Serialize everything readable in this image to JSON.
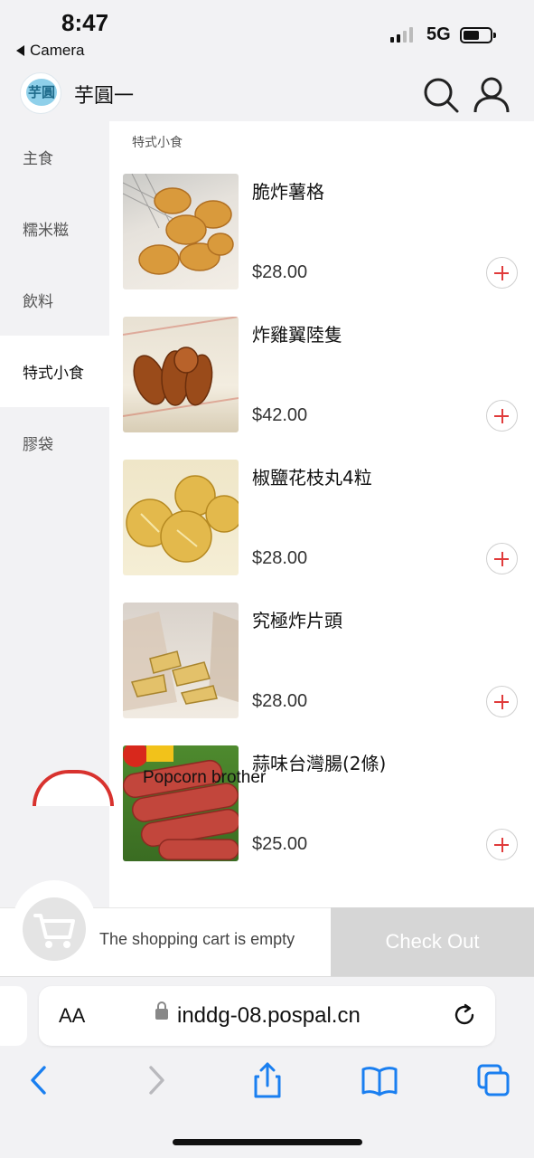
{
  "status_bar": {
    "time": "8:47",
    "back_label": "Camera",
    "network": "5G"
  },
  "header": {
    "shop_name": "芋圓一",
    "logo_text": "芋圓"
  },
  "sidebar": {
    "categories": [
      "主食",
      "糯米糍",
      "飲料",
      "特式小食",
      "膠袋"
    ],
    "active_index": 3
  },
  "section_title": "特式小食",
  "products": [
    {
      "name": "脆炸薯格",
      "price": "$28.00"
    },
    {
      "name": "炸雞翼陸隻",
      "price": "$42.00"
    },
    {
      "name": "椒鹽花枝丸4粒",
      "price": "$28.00"
    },
    {
      "name": "究極炸片頭",
      "price": "$28.00"
    },
    {
      "name": "蒜味台灣腸(2條)",
      "price": "$25.00"
    },
    {
      "name": "Popcorn brother"
    }
  ],
  "cart": {
    "empty_text": "The shopping cart is empty",
    "checkout_label": "Check Out"
  },
  "browser": {
    "text_size_label": "AA",
    "url": "inddg-08.pospal.cn"
  },
  "colors": {
    "accent": "#e03b3b",
    "checkout_disabled": "#d6d6d6",
    "safari_blue": "#1a7ff0"
  }
}
